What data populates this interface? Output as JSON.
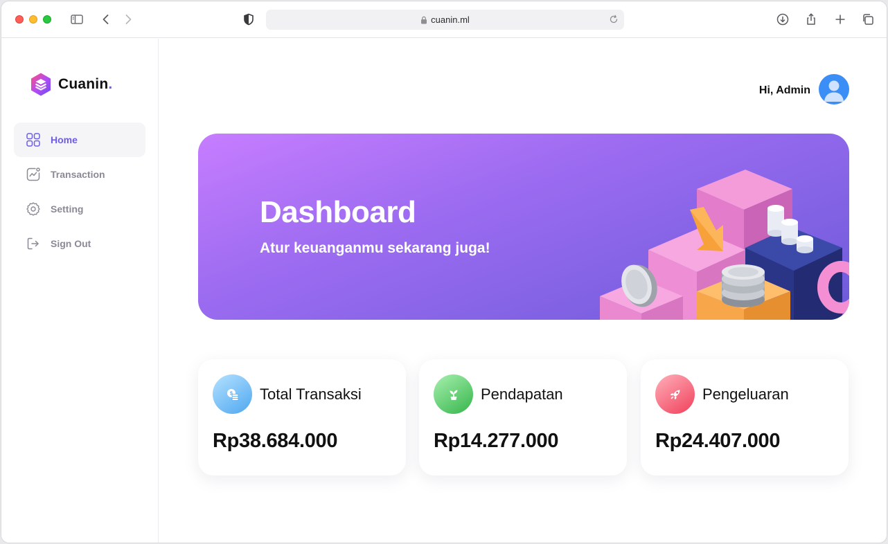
{
  "browser": {
    "url": "cuanin.ml",
    "icons": [
      "sidebar-toggle-icon",
      "back-icon",
      "forward-icon",
      "shield-icon",
      "lock-icon",
      "reload-icon",
      "download-icon",
      "share-icon",
      "new-tab-icon",
      "tabs-overview-icon"
    ]
  },
  "sidebar": {
    "brand": "Cuanin",
    "brand_dot": ".",
    "items": [
      {
        "label": "Home",
        "icon": "grid-icon",
        "active": true
      },
      {
        "label": "Transaction",
        "icon": "chart-icon",
        "active": false
      },
      {
        "label": "Setting",
        "icon": "gear-icon",
        "active": false
      },
      {
        "label": "Sign Out",
        "icon": "sign-out-icon",
        "active": false
      }
    ]
  },
  "header": {
    "greeting": "Hi, Admin"
  },
  "banner": {
    "title": "Dashboard",
    "subtitle": "Atur keuanganmu sekarang juga!"
  },
  "cards": [
    {
      "title": "Total Transaksi",
      "value": "Rp38.684.000",
      "icon": "coins-icon"
    },
    {
      "title": "Pendapatan",
      "value": "Rp14.277.000",
      "icon": "plant-icon"
    },
    {
      "title": "Pengeluaran",
      "value": "Rp24.407.000",
      "icon": "rocket-icon"
    }
  ],
  "colors": {
    "accent": "#6c5ce7",
    "banner_start": "#c77dff",
    "banner_end": "#6c5bd9",
    "muted_text": "#8a8a96"
  }
}
